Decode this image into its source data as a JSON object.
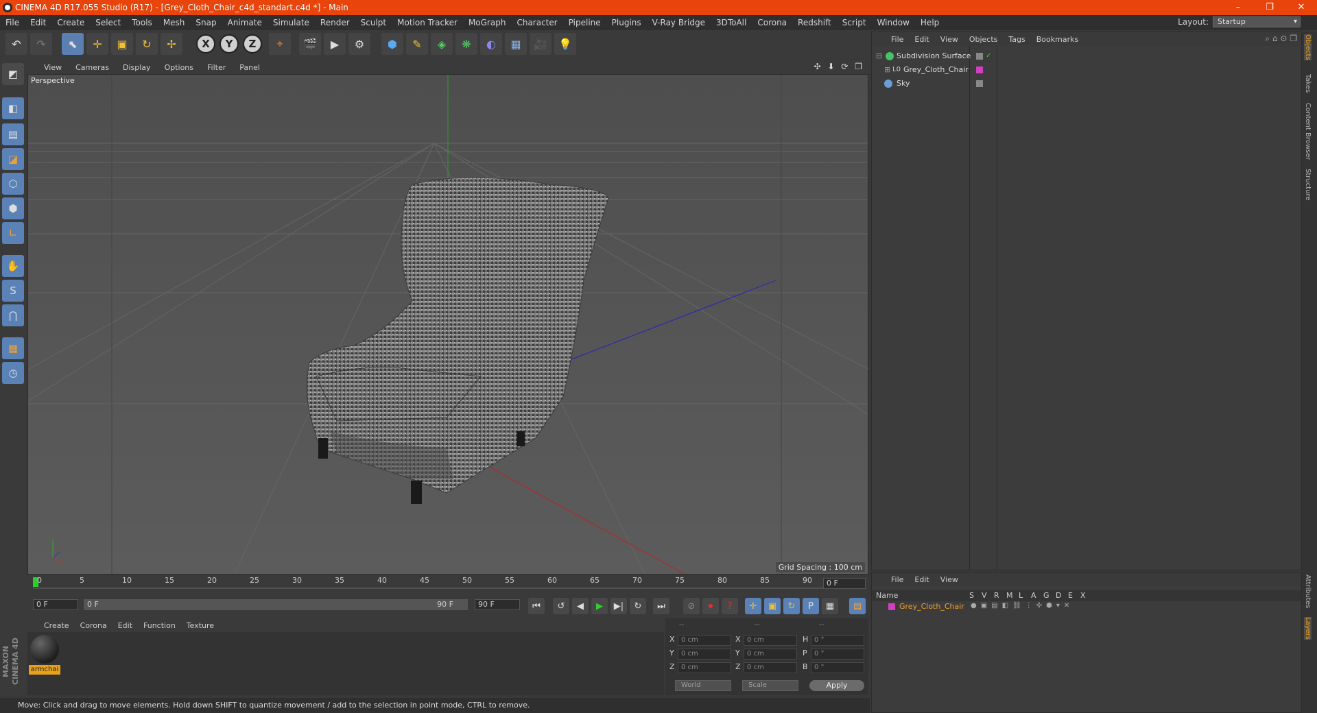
{
  "window": {
    "title": "CINEMA 4D R17.055 Studio (R17) - [Grey_Cloth_Chair_c4d_standart.c4d *] - Main",
    "min": "–",
    "restore": "❐",
    "close": "✕"
  },
  "menu": [
    "File",
    "Edit",
    "Create",
    "Select",
    "Tools",
    "Mesh",
    "Snap",
    "Animate",
    "Simulate",
    "Render",
    "Sculpt",
    "Motion Tracker",
    "MoGraph",
    "Character",
    "Pipeline",
    "Plugins",
    "V-Ray Bridge",
    "3DToAll",
    "Corona",
    "Redshift",
    "Script",
    "Window",
    "Help"
  ],
  "layout": {
    "label": "Layout:",
    "value": "Startup"
  },
  "toolbar": {
    "undo": "↶",
    "redo": "↷",
    "select": "⬉",
    "move": "✛",
    "scale": "▣",
    "rotate": "↻",
    "transform": "✢",
    "axis_x": "X",
    "axis_y": "Y",
    "axis_z": "Z",
    "coord": "⌖",
    "render_view": "🎬",
    "render_active": "▶",
    "render_settings": "⚙",
    "cube": "⬢",
    "spline": "✎",
    "nurbs": "◈",
    "array": "❋",
    "deformer": "◐",
    "floor": "▦",
    "camera": "🎥",
    "light": "💡"
  },
  "lefttools": [
    "◩",
    "◧",
    "▤",
    "◪",
    "⬡",
    "⬢",
    "∟",
    "✋",
    "S",
    "⋂",
    "▦",
    "◷"
  ],
  "maxon": "MAXON CINEMA 4D",
  "viewport": {
    "menu": [
      "View",
      "Cameras",
      "Display",
      "Options",
      "Filter",
      "Panel"
    ],
    "icons": "✣ ⬇ ⟳ ❐",
    "label": "Perspective",
    "grid_spacing": "Grid Spacing : 100 cm"
  },
  "timeline": {
    "ticks": [
      "0",
      "5",
      "10",
      "15",
      "20",
      "25",
      "30",
      "35",
      "40",
      "45",
      "50",
      "55",
      "60",
      "65",
      "70",
      "75",
      "80",
      "85",
      "90"
    ],
    "frame_field": "0 F",
    "start": "0 F",
    "range_start": "0 F",
    "range_end": "90 F",
    "end": "90 F"
  },
  "playback": [
    "⏮",
    "↺",
    "◀",
    "▶",
    "▶|",
    "↻",
    "⏭"
  ],
  "record": [
    "⊘",
    "⏺",
    "?",
    "✛",
    "▣",
    "↻",
    "P",
    "▦",
    "▤"
  ],
  "material": {
    "menu": [
      "Create",
      "Corona",
      "Edit",
      "Function",
      "Texture"
    ],
    "name": "armchai"
  },
  "coords": {
    "headers": [
      "--",
      "--",
      "--"
    ],
    "rows": [
      {
        "a": "X",
        "av": "0 cm",
        "b": "X",
        "bv": "0 cm",
        "c": "H",
        "cv": "0 °"
      },
      {
        "a": "Y",
        "av": "0 cm",
        "b": "Y",
        "bv": "0 cm",
        "c": "P",
        "cv": "0 °"
      },
      {
        "a": "Z",
        "av": "0 cm",
        "b": "Z",
        "bv": "0 cm",
        "c": "B",
        "cv": "0 °"
      }
    ],
    "mode1": "World",
    "mode2": "Scale",
    "apply": "Apply"
  },
  "status": "Move: Click and drag to move elements. Hold down SHIFT to quantize movement / add to the selection in point mode, CTRL to remove.",
  "objects": {
    "menu": [
      "File",
      "Edit",
      "View",
      "Objects",
      "Tags",
      "Bookmarks"
    ],
    "items": [
      {
        "name": "Subdivision Surface",
        "color": "#49c06a"
      },
      {
        "name": "Grey_Cloth_Chair",
        "color": "#cfcfcf"
      },
      {
        "name": "Sky",
        "color": "#6a9ed6"
      }
    ]
  },
  "layers": {
    "menu": [
      "File",
      "Edit",
      "View"
    ],
    "columns": [
      "Name",
      "S",
      "V",
      "R",
      "M",
      "L",
      "A",
      "G",
      "D",
      "E",
      "X"
    ],
    "row": "Grey_Cloth_Chair"
  },
  "sidetabs": [
    "Objects",
    "Takes",
    "Content Browser",
    "Structure",
    "Attributes",
    "Layers"
  ],
  "colors": {
    "accent": "#e8440c",
    "selected_blue": "#5b82b6",
    "material_tag": "#e8a21a",
    "layer_magenta": "#d040c0"
  }
}
